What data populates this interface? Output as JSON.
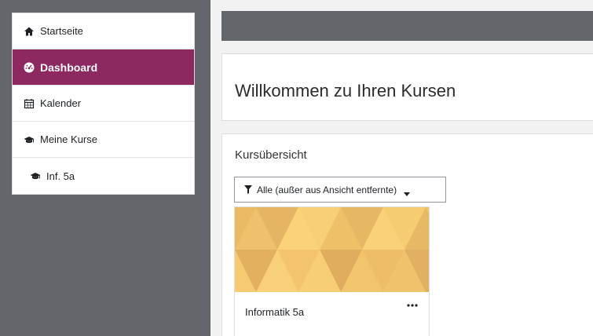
{
  "nav": {
    "items": [
      {
        "label": "Startseite",
        "icon": "home-icon"
      },
      {
        "label": "Dashboard",
        "icon": "dashboard-icon",
        "active": true
      },
      {
        "label": "Kalender",
        "icon": "calendar-icon"
      },
      {
        "label": "Meine Kurse",
        "icon": "graduation-cap-icon"
      },
      {
        "label": "Inf. 5a",
        "icon": "graduation-cap-icon"
      }
    ]
  },
  "welcome": {
    "title": "Willkommen zu Ihren Kursen"
  },
  "overview": {
    "title": "Kursübersicht",
    "filter_label": "Alle (außer aus Ansicht entfernte)",
    "courses": [
      {
        "name": "Informatik 5a"
      }
    ]
  },
  "colors": {
    "drawer_bg": "#63666a",
    "active_item": "#8e2861",
    "course_pattern": "#f4c86a"
  }
}
